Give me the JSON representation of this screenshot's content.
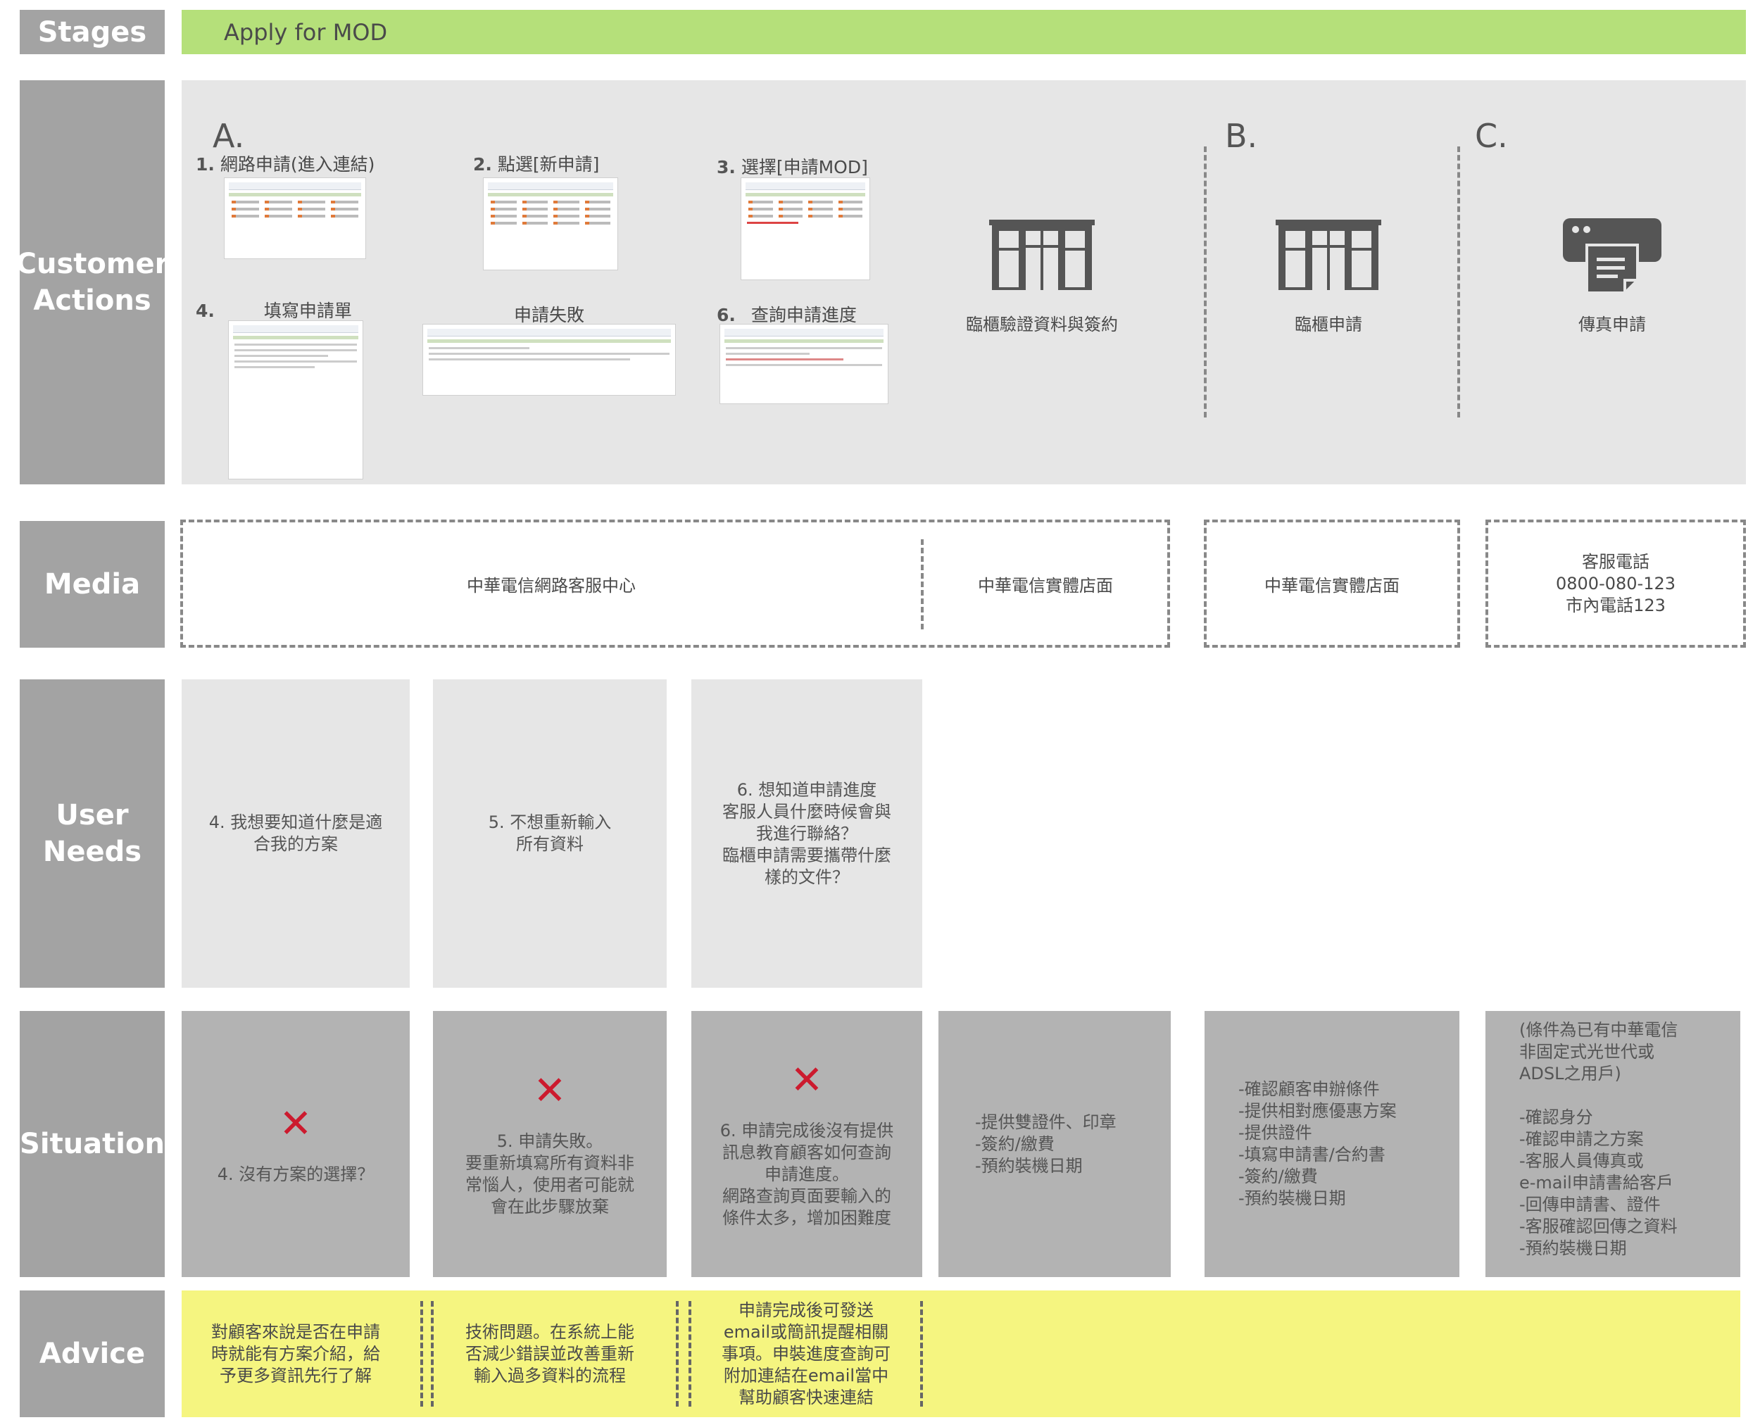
{
  "rows": {
    "stages": "Stages",
    "customer_actions": "Customer\nActions",
    "media": "Media",
    "user_needs": "User\nNeeds",
    "situation": "Situation",
    "advice": "Advice"
  },
  "stage_banner": "Apply for MOD",
  "colors": {
    "label_gray": "#a3a3a3",
    "stage_green": "#b5e07a",
    "panel_light": "#e6e6e6",
    "card_gray": "#b3b3b3",
    "advice_yellow": "#f5f580",
    "cross_red": "#cc1a2e"
  },
  "actions": {
    "sections": [
      "A.",
      "B.",
      "C."
    ],
    "steps": [
      {
        "num": "1.",
        "text": "網路申請(進入連結)"
      },
      {
        "num": "2.",
        "text": "點選[新申請]"
      },
      {
        "num": "3.",
        "text": "選擇[申請MOD]"
      },
      {
        "num": "4.",
        "text": "填寫申請單"
      },
      {
        "num": "",
        "text": "申請失敗"
      },
      {
        "num": "6.",
        "text": "查詢申請進度"
      }
    ],
    "icon_labels": {
      "store_verify": "臨櫃驗證資料與簽約",
      "store_apply": "臨櫃申請",
      "fax_apply": "傳真申請"
    }
  },
  "media": {
    "online": "中華電信網路客服中心",
    "store_a": "中華電信實體店面",
    "store_b": "中華電信實體店面",
    "phone": "客服電話\n0800-080-123\n市內電話123"
  },
  "user_needs": [
    "4. 我想要知道什麼是適\n合我的方案",
    "5. 不想重新輸入\n所有資料",
    "6. 想知道申請進度\n客服人員什麼時候會與\n我進行聯絡？\n臨櫃申請需要攜帶什麼\n樣的文件？"
  ],
  "situation": {
    "cross_symbol": "✕",
    "items": [
      "4. 沒有方案的選擇？",
      "5. 申請失敗。\n要重新填寫所有資料非\n常惱人，使用者可能就\n會在此步驟放棄",
      "6. 申請完成後沒有提供\n訊息教育顧客如何查詢\n申請進度。\n網路查詢頁面要輸入的\n條件太多，增加困難度",
      "-提供雙證件、印章\n-簽約/繳費\n-預約裝機日期",
      "-確認顧客申辦條件\n-提供相對應優惠方案\n-提供證件\n-填寫申請書/合約書\n-簽約/繳費\n-預約裝機日期",
      "(條件為已有中華電信\n非固定式光世代或\nADSL之用戶)\n\n-確認身分\n-確認申請之方案\n-客服人員傳真或\ne-mail申請書給客戶\n-回傳申請書、證件\n-客服確認回傳之資料\n-預約裝機日期"
    ]
  },
  "advice": [
    "對顧客來說是否在申請\n時就能有方案介紹，給\n予更多資訊先行了解",
    "技術問題。在系統上能\n否減少錯誤並改善重新\n輸入過多資料的流程",
    "申請完成後可發送\nemail或簡訊提醒相關\n事項。申裝進度查詢可\n附加連結在email當中\n幫助顧客快速連結"
  ]
}
